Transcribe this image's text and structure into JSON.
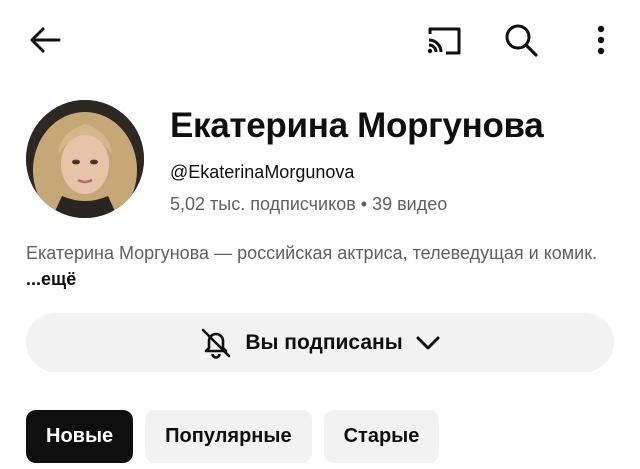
{
  "channel": {
    "name": "Екатерина Моргунова",
    "handle": "@EkaterinaMorgunova",
    "stats": "5,02 тыс. подписчиков • 39 видео",
    "description": "Екатерина Моргунова — российская актриса, телеведущая и комик. ",
    "description_more": "...ещё"
  },
  "subscribe": {
    "label": "Вы подписаны"
  },
  "tabs": [
    {
      "label": "Новые",
      "active": true
    },
    {
      "label": "Популярные",
      "active": false
    },
    {
      "label": "Старые",
      "active": false
    }
  ],
  "colors": {
    "text": "#0f0f0f",
    "secondary": "#606060",
    "chip_bg": "#f2f2f2",
    "active_chip_bg": "#0f0f0f"
  },
  "icons": [
    "arrow-back-icon",
    "cast-icon",
    "search-icon",
    "more-vert-icon",
    "bell-off-icon",
    "chevron-down-icon"
  ]
}
